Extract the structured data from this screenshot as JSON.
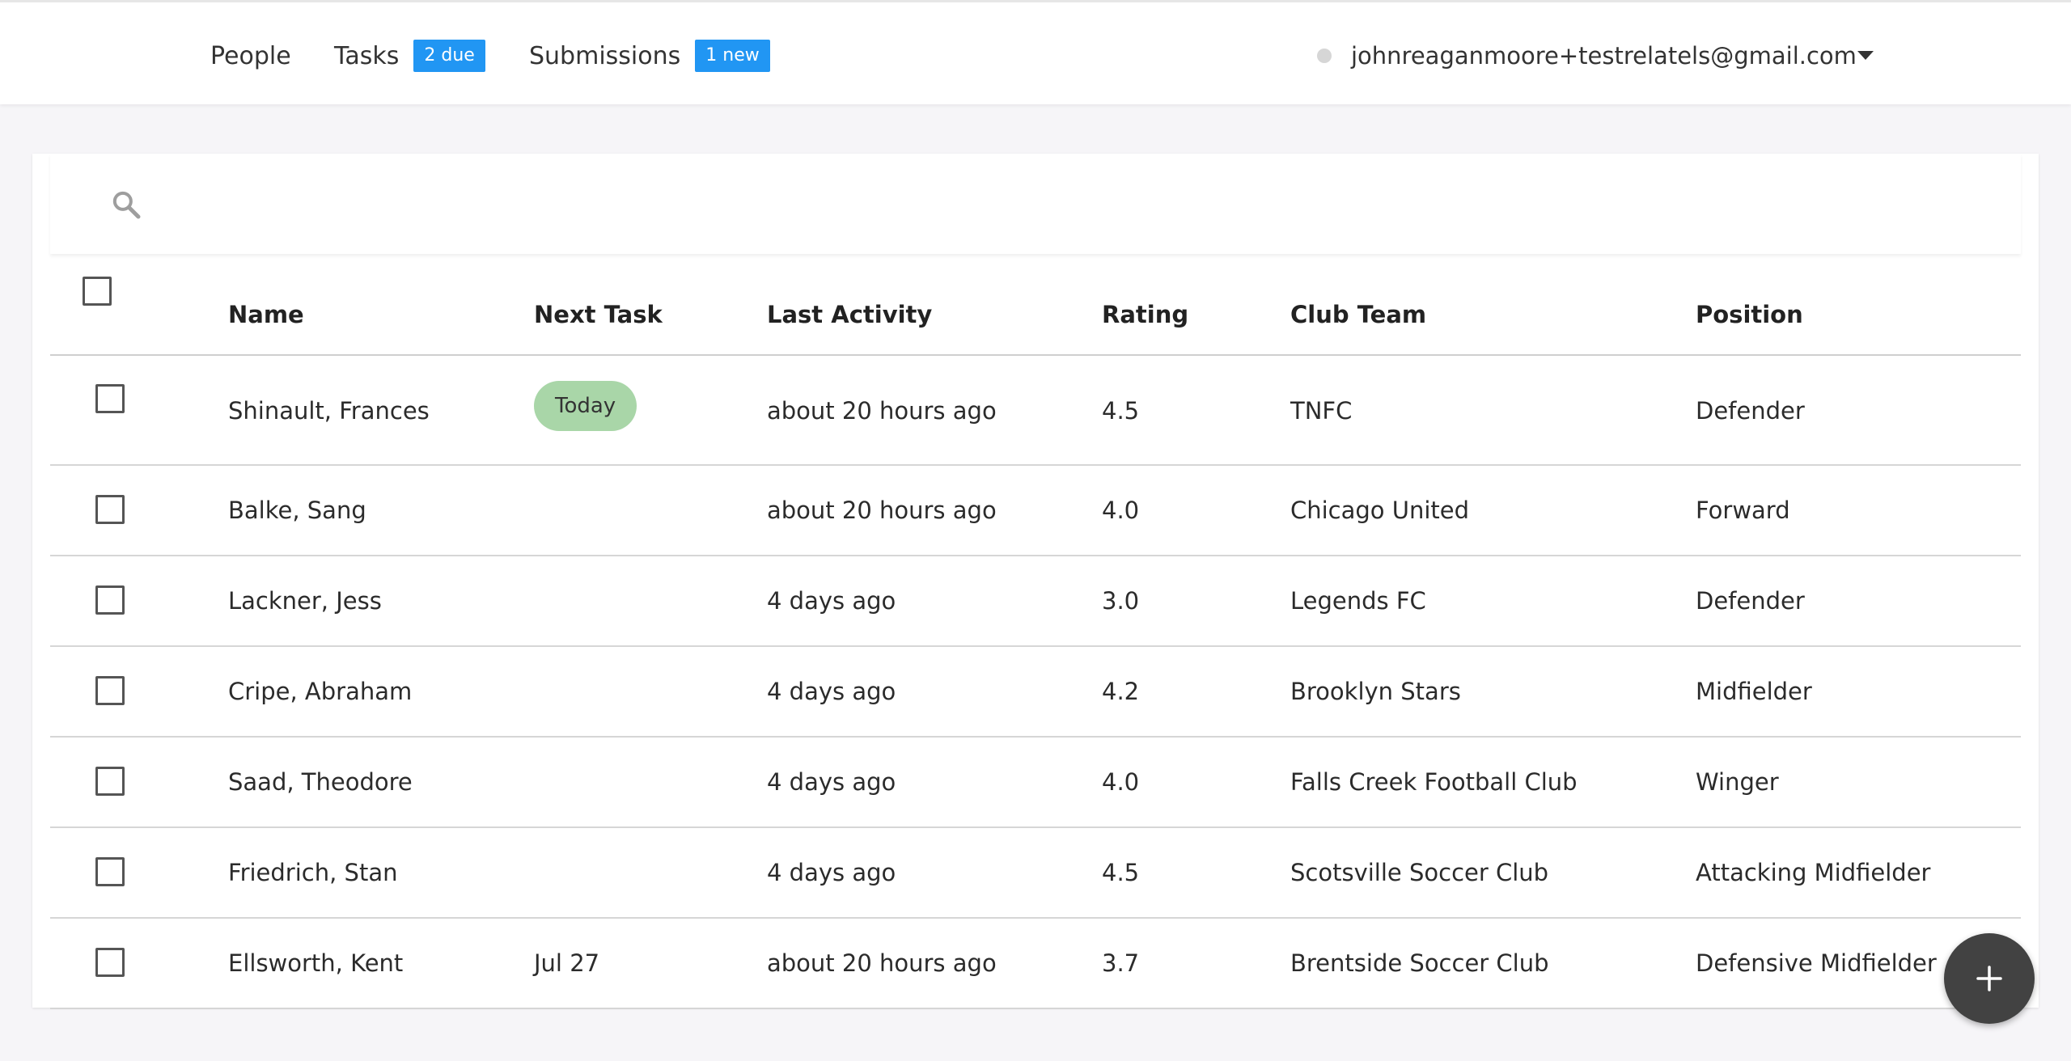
{
  "nav": {
    "people": "People",
    "tasks": "Tasks",
    "tasks_badge": "2 due",
    "submissions": "Submissions",
    "submissions_badge": "1 new",
    "user_email": "johnreaganmoore+testrelatels@gmail.com"
  },
  "search": {
    "placeholder": ""
  },
  "table": {
    "headers": {
      "name": "Name",
      "next_task": "Next Task",
      "last_activity": "Last Activity",
      "rating": "Rating",
      "club_team": "Club Team",
      "position": "Position"
    },
    "rows": [
      {
        "name": "Shinault, Frances",
        "next_task": "Today",
        "last_activity": "about 20 hours ago",
        "rating": "4.5",
        "club_team": "TNFC",
        "position": "Defender"
      },
      {
        "name": "Balke, Sang",
        "next_task": "",
        "last_activity": "about 20 hours ago",
        "rating": "4.0",
        "club_team": "Chicago United",
        "position": "Forward"
      },
      {
        "name": "Lackner, Jess",
        "next_task": "",
        "last_activity": "4 days ago",
        "rating": "3.0",
        "club_team": "Legends FC",
        "position": "Defender"
      },
      {
        "name": "Cripe, Abraham",
        "next_task": "",
        "last_activity": "4 days ago",
        "rating": "4.2",
        "club_team": "Brooklyn Stars",
        "position": "Midfielder"
      },
      {
        "name": "Saad, Theodore",
        "next_task": "",
        "last_activity": "4 days ago",
        "rating": "4.0",
        "club_team": "Falls Creek Football Club",
        "position": "Winger"
      },
      {
        "name": "Friedrich, Stan",
        "next_task": "",
        "last_activity": "4 days ago",
        "rating": "4.5",
        "club_team": "Scotsville Soccer Club",
        "position": "Attacking Midfielder"
      },
      {
        "name": "Ellsworth, Kent",
        "next_task": "Jul 27",
        "last_activity": "about 20 hours ago",
        "rating": "3.7",
        "club_team": "Brentside Soccer Club",
        "position": "Defensive Midfielder"
      }
    ]
  },
  "icons": {
    "search": "search-icon",
    "dropdown": "chevron-down-icon",
    "add": "plus-icon"
  },
  "colors": {
    "badge": "#2196f3",
    "today_pill": "#a9d6a8",
    "fab": "#424242"
  }
}
